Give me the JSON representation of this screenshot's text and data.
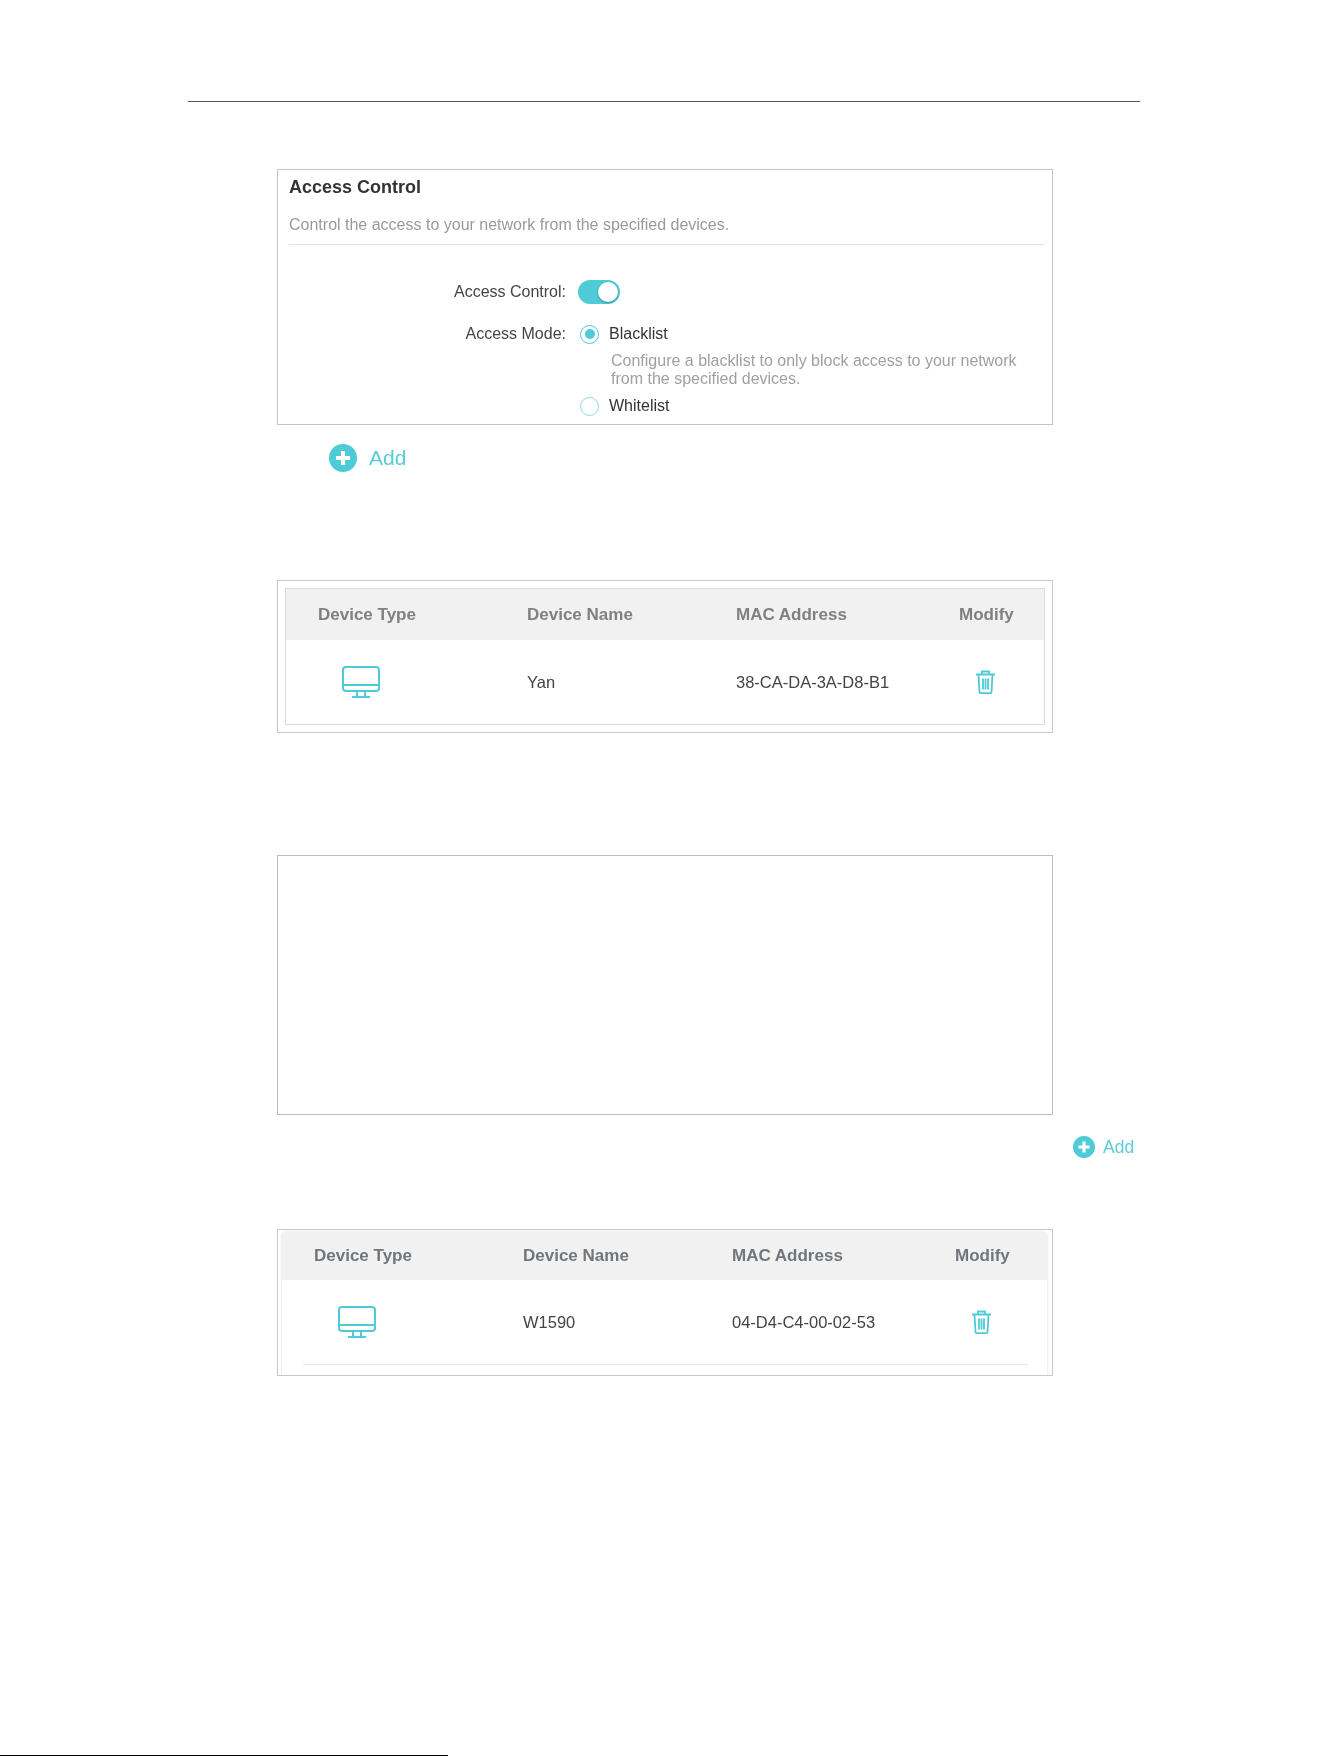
{
  "access_control": {
    "title": "Access Control",
    "description": "Control the access to your network from the specified devices.",
    "toggle": {
      "label": "Access Control:",
      "on": true
    },
    "access_mode": {
      "label": "Access Mode:",
      "options": [
        {
          "label": "Blacklist",
          "selected": true,
          "description": "Configure a blacklist to only block access to your network from the specified devices."
        },
        {
          "label": "Whitelist",
          "selected": false
        }
      ]
    }
  },
  "add_button_top": {
    "label": "Add"
  },
  "device_table_top": {
    "columns": [
      "Device Type",
      "Device Name",
      "MAC Address",
      "Modify"
    ],
    "rows": [
      {
        "device_name": "Yan",
        "mac_address": "38-CA-DA-3A-D8-B1"
      }
    ]
  },
  "add_button_side": {
    "label": "Add"
  },
  "device_table_bottom": {
    "columns": [
      "Device Type",
      "Device Name",
      "MAC Address",
      "Modify"
    ],
    "rows": [
      {
        "device_name": "W1590",
        "mac_address": "04-D4-C4-00-02-53"
      }
    ]
  }
}
